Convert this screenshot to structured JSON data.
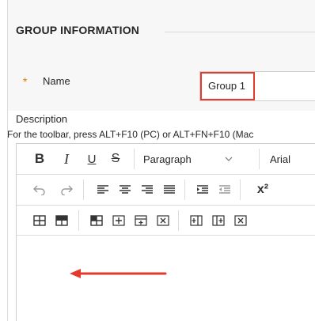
{
  "section": {
    "title": "GROUP INFORMATION"
  },
  "name_field": {
    "required_marker": "*",
    "label": "Name",
    "value": "Group 1"
  },
  "description": {
    "label": "Description",
    "toolbar_hint": "For the toolbar, press ALT+F10 (PC) or ALT+FN+F10 (Mac"
  },
  "toolbar": {
    "bold_label": "B",
    "italic_label": "I",
    "underline_label": "U",
    "strikethrough_label": "S",
    "paragraph_label": "Paragraph",
    "font_label": "Arial",
    "superscript_label": "x²"
  },
  "colors": {
    "highlight": "#e23b2e",
    "required": "#e07800",
    "arrow": "#e23b2e"
  }
}
